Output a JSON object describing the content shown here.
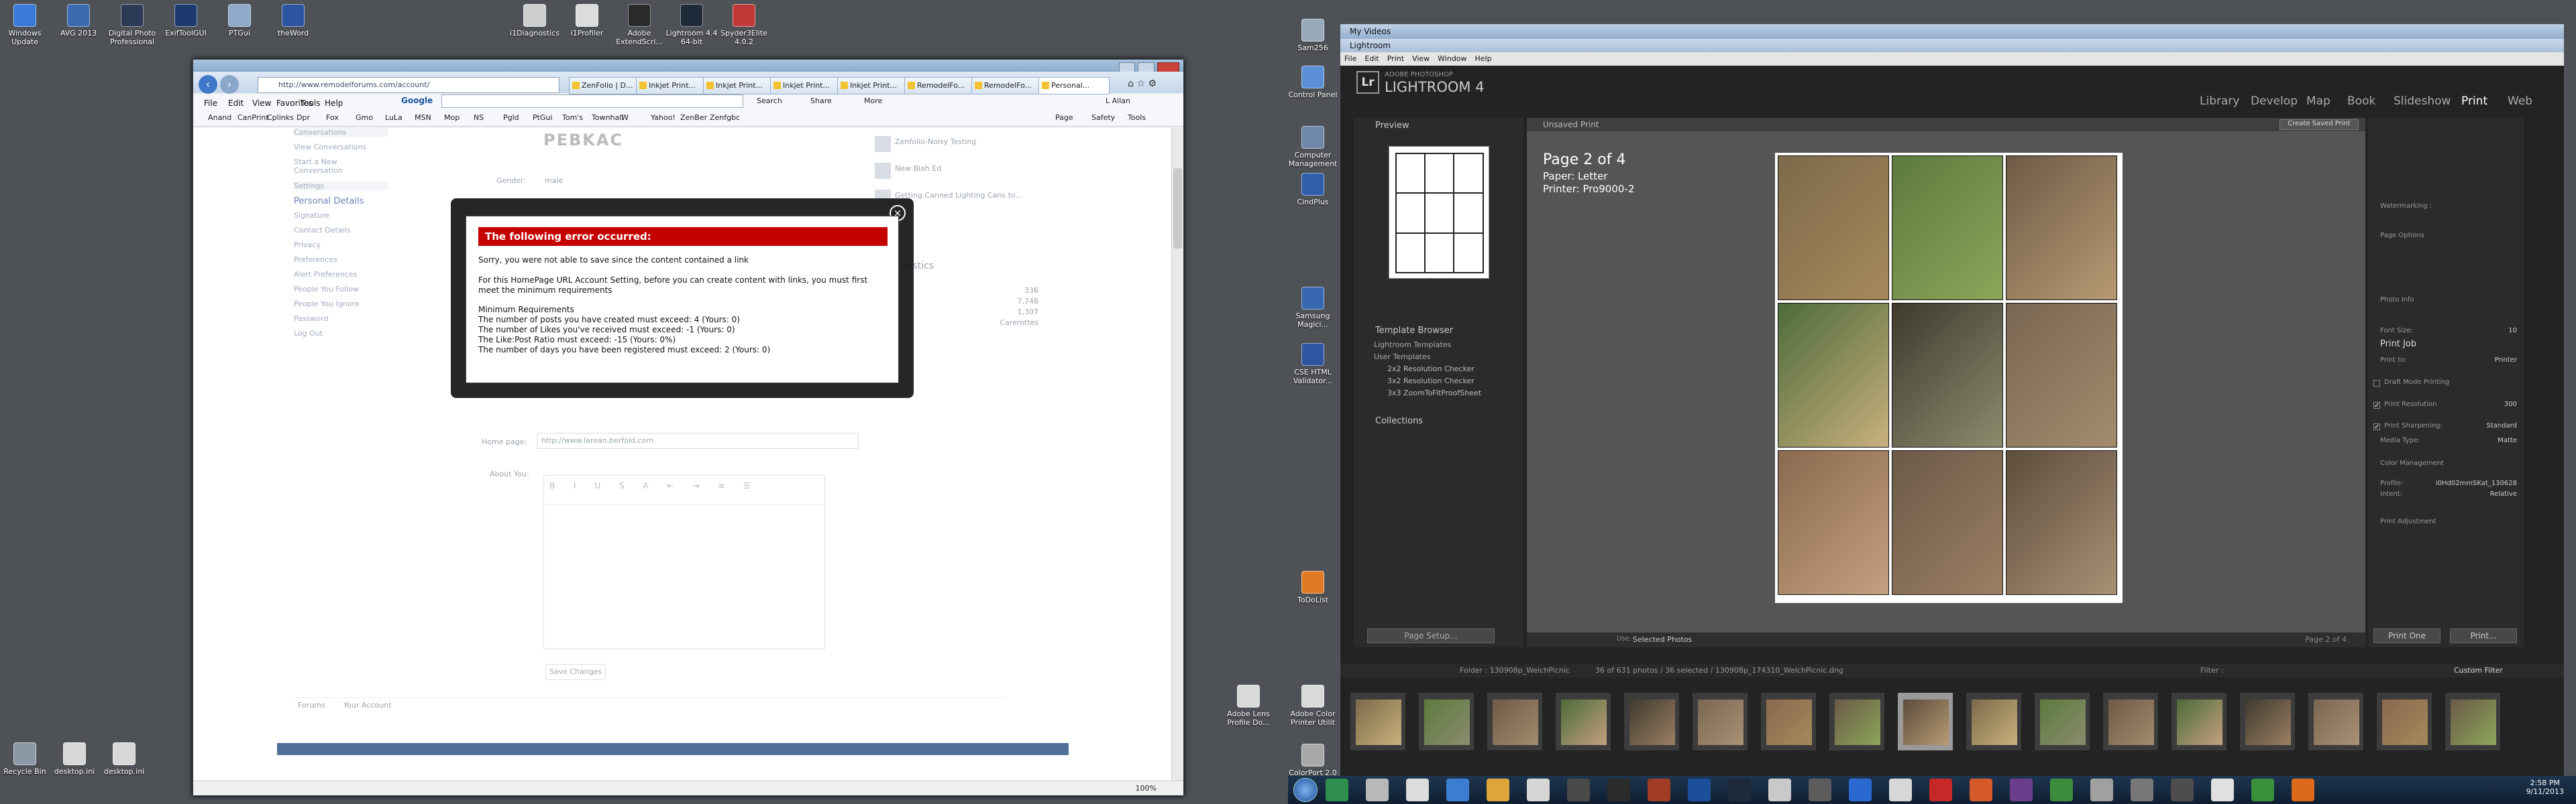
{
  "desktop_left_icons": [
    {
      "label": "Windows Update",
      "color": "#3a7ad8"
    },
    {
      "label": "AVG 2013",
      "color": "#3a6ab0"
    },
    {
      "label": "Digital Photo Professional",
      "color": "#2b3a55"
    },
    {
      "label": "ExifToolGUI",
      "color": "#1c3a6e"
    },
    {
      "label": "PTGui",
      "color": "#8fa9c9"
    },
    {
      "label": "theWord",
      "color": "#2c55a0"
    }
  ],
  "desktop_top_icons": [
    {
      "label": "i1Diagnostics",
      "color": "#cfcfcf"
    },
    {
      "label": "i1Profiler",
      "color": "#dcdcdc"
    },
    {
      "label": "Adobe ExtendScri...",
      "color": "#2a2a2a"
    },
    {
      "label": "Lightroom 4.4 64-bit",
      "color": "#1f2a3a"
    },
    {
      "label": "Spyder3Elite 4.0.2",
      "color": "#c23838"
    }
  ],
  "desktop_bottom_icons": [
    {
      "label": "Recycle Bin",
      "color": "#8d98a6"
    },
    {
      "label": "desktop.ini",
      "color": "#d8d8d8"
    },
    {
      "label": "desktop.ini",
      "color": "#d8d8d8"
    }
  ],
  "desktop_right_icons": [
    {
      "label": "Sam256",
      "color": "#9ab"
    },
    {
      "label": "Control Panel",
      "color": "#5b8fd6"
    },
    {
      "label": "Computer Management",
      "color": "#6f88a8"
    },
    {
      "label": "CindPlus",
      "color": "#2f5fa8"
    },
    {
      "label": "Samsung Magici...",
      "color": "#3767b0"
    },
    {
      "label": "CSE HTML Validator...",
      "color": "#2f55a0"
    },
    {
      "label": "ToDoList",
      "color": "#e07b25"
    },
    {
      "label": "Adobe Lens Profile Do...",
      "color": "#d9d9d9"
    },
    {
      "label": "Adobe Color Printer Utilit",
      "color": "#d9d9d9"
    },
    {
      "label": "ColorPort 2.0",
      "color": "#a8a8a8"
    }
  ],
  "ie": {
    "address": "http://www.remodelforums.com/account/",
    "search_engine": "Google",
    "tabs": [
      "ZenFolio | D...",
      "Inkjet Print...",
      "Inkjet Print...",
      "Inkjet Print...",
      "Inkjet Print...",
      "RemodelFo...",
      "RemodelFo...",
      "Personal..."
    ],
    "menu": [
      "File",
      "Edit",
      "View",
      "Favorites",
      "Tools",
      "Help"
    ],
    "toolbar_labels": [
      "Search",
      "Share",
      "More"
    ],
    "user": "L Allan",
    "favorites": [
      "Anand",
      "CanPrint",
      "Cplinks",
      "Dpr",
      "Fox",
      "Gmo",
      "LuLa",
      "MSN",
      "Mop",
      "NS",
      "Pgld",
      "PtGui",
      "Tom's",
      "Townhall",
      "W",
      "Yahoo!",
      "ZenBer",
      "Zenfgbc"
    ],
    "cmd_labels": [
      "Page",
      "Safety",
      "Tools"
    ],
    "sidebar_links": [
      "Conversations",
      "View Conversations",
      "Start a New Conversation",
      "Settings",
      "Personal Details",
      "Signature",
      "Contact Details",
      "Privacy",
      "Preferences",
      "Alert Preferences",
      "People You Follow",
      "People You Ignore",
      "Password",
      "Log Out"
    ],
    "site_logo": "PEBKAC",
    "gender_label": "Gender:",
    "gender_value": "male",
    "homepage_label": "Home page:",
    "homepage_value": "http://www.larean.berfold.com",
    "about_label": "About You:",
    "save_label": "Save Changes",
    "footer_links": [
      "Forums",
      "Your Account"
    ],
    "zoom": "100%",
    "right_col": {
      "messages": [
        "Zenfolio-Noisy Testing",
        "New Blah Ed",
        "Getting Canned Lighting Cans to..."
      ],
      "stats_title": "Statistics",
      "stats_values": [
        "336",
        "7,748",
        "1,307",
        "Carerottes"
      ]
    }
  },
  "error": {
    "title": "The following error occurred:",
    "line1": "Sorry, you were not able to save since the content contained a link",
    "line2": "For this HomePage URL Account Setting, before you can create content with links, you must first meet the minimum requirements",
    "req_title": "Minimum Requirements",
    "reqs": [
      "The number of posts you have created must exceed: 4 (Yours: 0)",
      "The number of Likes you've received must exceed: -1 (Yours: 0)",
      "The Like:Post Ratio must exceed: -15 (Yours: 0%)",
      "The number of days you have been registered must exceed: 2 (Yours: 0)"
    ]
  },
  "lightroom": {
    "outer_title": "My Videos",
    "window_title": "Lightroom",
    "menu": [
      "File",
      "Edit",
      "Print",
      "View",
      "Window",
      "Help"
    ],
    "brand_small": "ADOBE PHOTOSHOP",
    "brand": "LIGHTROOM 4",
    "modules": [
      "Library",
      "Develop",
      "Map",
      "Book",
      "Slideshow",
      "Print",
      "Web"
    ],
    "active_module": "Print",
    "preview_label": "Preview",
    "template_browser": "Template Browser",
    "templates": [
      "Lightroom Templates",
      "User Templates",
      "2x2 Resolution Checker",
      "3x2 Resolution Checker",
      "3x3 ZoomToFitProofSheet"
    ],
    "collections": "Collections",
    "page_setup": "Page Setup...",
    "unsaved": "Unsaved Print",
    "create_saved": "Create Saved Print",
    "page_info": "Page 2 of 4",
    "paper": "Paper:  Letter",
    "printer": "Printer:  Pro9000-2",
    "use_label": "Use:",
    "use_value": "Selected Photos",
    "page_footer": "Page 2 of 4",
    "right_sections": [
      "Watermarking :",
      "Page Options",
      "Photo Info",
      "Font Size:",
      "Print Job",
      "Print to:",
      "Draft Mode Printing",
      "Print Resolution",
      "Print Sharpening:",
      "Media Type:",
      "Color Management",
      "Profile:",
      "Intent:",
      "Print Adjustment"
    ],
    "print_to": "Printer",
    "resolution": "300",
    "sharpening": "Standard",
    "media": "Matte",
    "profile": "i0Hd02mmSKat_130628",
    "intent": "Relative",
    "font_size": "10",
    "print_one": "Print One",
    "print": "Print...",
    "filmstrip_path": "Folder : 130908p_WelchPicnic",
    "filmstrip_count": "36 of 631 photos / 36 selected / 130908p_174310_WelchPicnic.dng",
    "filter_label": "Filter :",
    "filter_value": "Custom Filter"
  },
  "taskbar": {
    "time": "2:58 PM",
    "date": "9/11/2013"
  }
}
